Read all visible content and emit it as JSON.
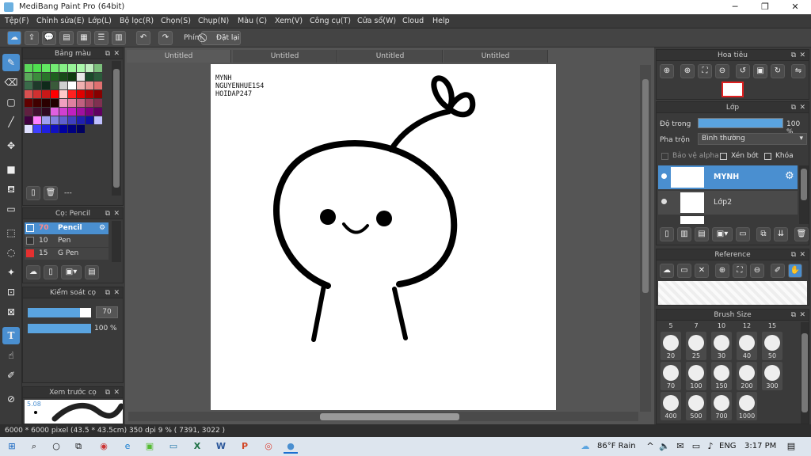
{
  "window": {
    "title": "MediBang Paint Pro (64bit)"
  },
  "menu": [
    "Tệp(F)",
    "Chỉnh sửa(E)",
    "Lớp(L)",
    "Bộ lọc(R)",
    "Chọn(S)",
    "Chụp(N)",
    "Màu (C)",
    "Xem(V)",
    "Công cụ(T)",
    "Cửa sổ(W)",
    "Cloud",
    "Help"
  ],
  "toolbar": {
    "shortcut_label": "Phím",
    "reset_label": "Đặt lại"
  },
  "color_panel": {
    "title": "Bảng màu",
    "swatch_label": "---"
  },
  "brush_panel": {
    "title": "Cọ: Pencil",
    "items": [
      {
        "size": "70",
        "name": "Pencil",
        "color": "#4a8fd0"
      },
      {
        "size": "10",
        "name": "Pen",
        "color": "#333"
      },
      {
        "size": "15",
        "name": "G Pen",
        "color": "#e53030"
      }
    ]
  },
  "brush_control": {
    "title": "Kiểm soát cọ",
    "size": "70",
    "opacity": "100 %"
  },
  "brush_preview": {
    "title": "Xem trước cọ",
    "size": "5.08"
  },
  "doc_tabs": [
    "Untitled",
    "Untitled",
    "Untitled",
    "Untitled"
  ],
  "canvas_text": [
    "MYNH",
    "NGUYENHUE1S4",
    "HOIDAP247"
  ],
  "navigator": {
    "title": "Hoa tiêu"
  },
  "layer_panel": {
    "title": "Lớp",
    "opacity_label": "Độ trong",
    "opacity_value": "100 %",
    "opacity": 1.0,
    "blend_label": "Pha trộn",
    "blend_value": "Bình thường",
    "alpha_label": "Bảo vệ alpha",
    "clip_label": "Xén bớt",
    "lock_label": "Khóa",
    "layers": [
      {
        "name": "MYNH",
        "selected": true
      },
      {
        "name": "Lớp2",
        "selected": false
      }
    ]
  },
  "reference": {
    "title": "Reference"
  },
  "brush_size": {
    "title": "Brush Size",
    "top_labels": [
      "5",
      "7",
      "10",
      "12",
      "15"
    ],
    "rows": [
      [
        "20",
        "25",
        "30",
        "40",
        "50"
      ],
      [
        "70",
        "100",
        "150",
        "200",
        "300"
      ],
      [
        "400",
        "500",
        "700",
        "1000"
      ]
    ]
  },
  "status": {
    "text": "6000 * 6000 pixel  (43.5 * 43.5cm)   350 dpi   9 %   ( 7391, 3022 )"
  },
  "taskbar": {
    "weather": "86°F  Rain",
    "lang": "ENG",
    "time": "3:17 PM"
  }
}
